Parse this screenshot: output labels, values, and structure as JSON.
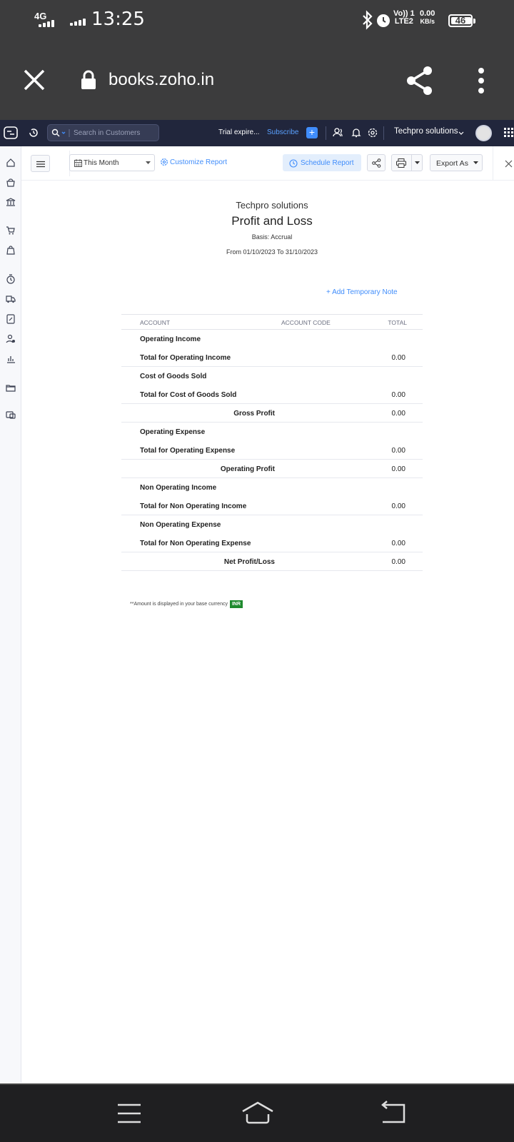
{
  "status_bar": {
    "network": "4G",
    "time": "13:25",
    "volte_line1": "Vo)) 1",
    "volte_line2": "LTE2",
    "speed_value": "0.00",
    "speed_unit": "KB/s",
    "battery": "46"
  },
  "browser": {
    "url": "books.zoho.in",
    "icons": [
      "close-icon",
      "lock-icon",
      "share-icon",
      "more-vert-icon"
    ]
  },
  "app_header": {
    "search_placeholder": "Search in Customers",
    "trial_text": "Trial expire...",
    "subscribe_label": "Subscribe",
    "plus_label": "+",
    "org_name": "Techpro solutions",
    "icons": [
      "app-logo-icon",
      "recent-icon",
      "search-icon",
      "add-icon",
      "users-icon",
      "bell-icon",
      "gear-icon",
      "avatar",
      "apps-grid-icon"
    ]
  },
  "sidebar": {
    "icons": [
      "home-icon",
      "items-icon",
      "banking-icon",
      "sales-icon",
      "purchases-icon",
      "time-tracking-icon",
      "ewaybill-icon",
      "accountant-icon",
      "payroll-icon",
      "reports-icon",
      "documents-icon",
      "integrations-icon"
    ]
  },
  "toolbar": {
    "period": "This Month",
    "customize_label": "Customize Report",
    "schedule_label": "Schedule Report",
    "export_label": "Export As"
  },
  "report": {
    "org": "Techpro solutions",
    "title": "Profit and Loss",
    "basis": "Basis: Accrual",
    "range": "From 01/10/2023 To 31/10/2023",
    "add_note": "+ Add Temporary Note",
    "columns": {
      "account": "ACCOUNT",
      "code": "ACCOUNT CODE",
      "total": "TOTAL"
    },
    "rows": [
      {
        "label": "Operating Income",
        "amount": "",
        "kind": "heading"
      },
      {
        "label": "Total for Operating Income",
        "amount": "0.00",
        "kind": "total"
      },
      {
        "label": "Cost of Goods Sold",
        "amount": "",
        "kind": "heading"
      },
      {
        "label": "Total for Cost of Goods Sold",
        "amount": "0.00",
        "kind": "total"
      },
      {
        "label": "Gross Profit",
        "amount": "0.00",
        "kind": "summary"
      },
      {
        "label": "Operating Expense",
        "amount": "",
        "kind": "heading"
      },
      {
        "label": "Total for Operating Expense",
        "amount": "0.00",
        "kind": "total"
      },
      {
        "label": "Operating Profit",
        "amount": "0.00",
        "kind": "summary"
      },
      {
        "label": "Non Operating Income",
        "amount": "",
        "kind": "heading"
      },
      {
        "label": "Total for Non Operating Income",
        "amount": "0.00",
        "kind": "total"
      },
      {
        "label": "Non Operating Expense",
        "amount": "",
        "kind": "heading"
      },
      {
        "label": "Total for Non Operating Expense",
        "amount": "0.00",
        "kind": "total"
      },
      {
        "label": "Net Profit/Loss",
        "amount": "0.00",
        "kind": "summary"
      }
    ],
    "currency_note": "**Amount is displayed in your base currency",
    "currency_badge": "INR"
  },
  "colors": {
    "status_bg": "#3c3c3d",
    "header_bg": "#21263c",
    "accent": "#408dfb",
    "badge_green": "#1f8a2e"
  }
}
